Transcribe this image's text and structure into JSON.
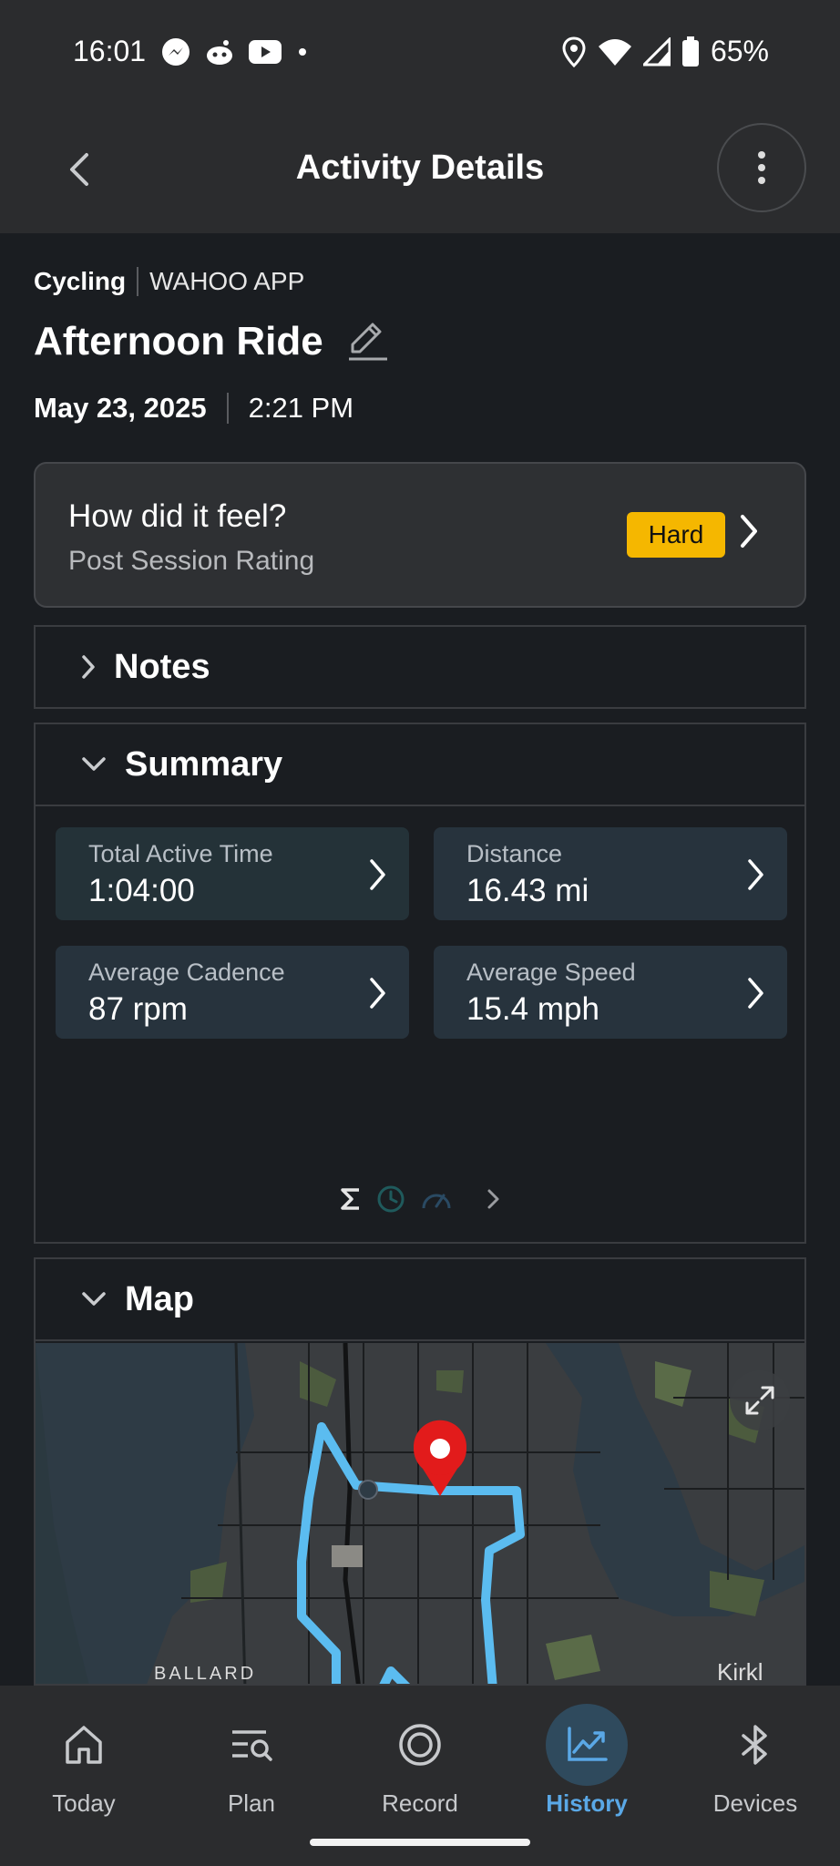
{
  "status_bar": {
    "time": "16:01",
    "battery": "65%"
  },
  "app_bar": {
    "title": "Activity Details"
  },
  "activity": {
    "type": "Cycling",
    "source": "WAHOO APP",
    "title": "Afternoon Ride",
    "date": "May 23, 2025",
    "time": "2:21 PM"
  },
  "feel": {
    "question": "How did it feel?",
    "subtitle": "Post Session Rating",
    "rating": "Hard",
    "rating_color": "#f5b700"
  },
  "notes": {
    "title": "Notes"
  },
  "summary": {
    "title": "Summary",
    "metrics": [
      {
        "label": "Total Active Time",
        "value": "1:04:00"
      },
      {
        "label": "Distance",
        "value": "16.43 mi"
      },
      {
        "label": "Average Cadence",
        "value": "87 rpm"
      },
      {
        "label": "Average Speed",
        "value": "15.4 mph"
      }
    ]
  },
  "map": {
    "title": "Map",
    "label_left": "BALLARD",
    "label_right": "Kirkl",
    "route_color": "#5bbcf0"
  },
  "nav": {
    "items": [
      {
        "label": "Today"
      },
      {
        "label": "Plan"
      },
      {
        "label": "Record"
      },
      {
        "label": "History"
      },
      {
        "label": "Devices"
      }
    ],
    "active": "History",
    "active_color": "#5aa8e6"
  }
}
